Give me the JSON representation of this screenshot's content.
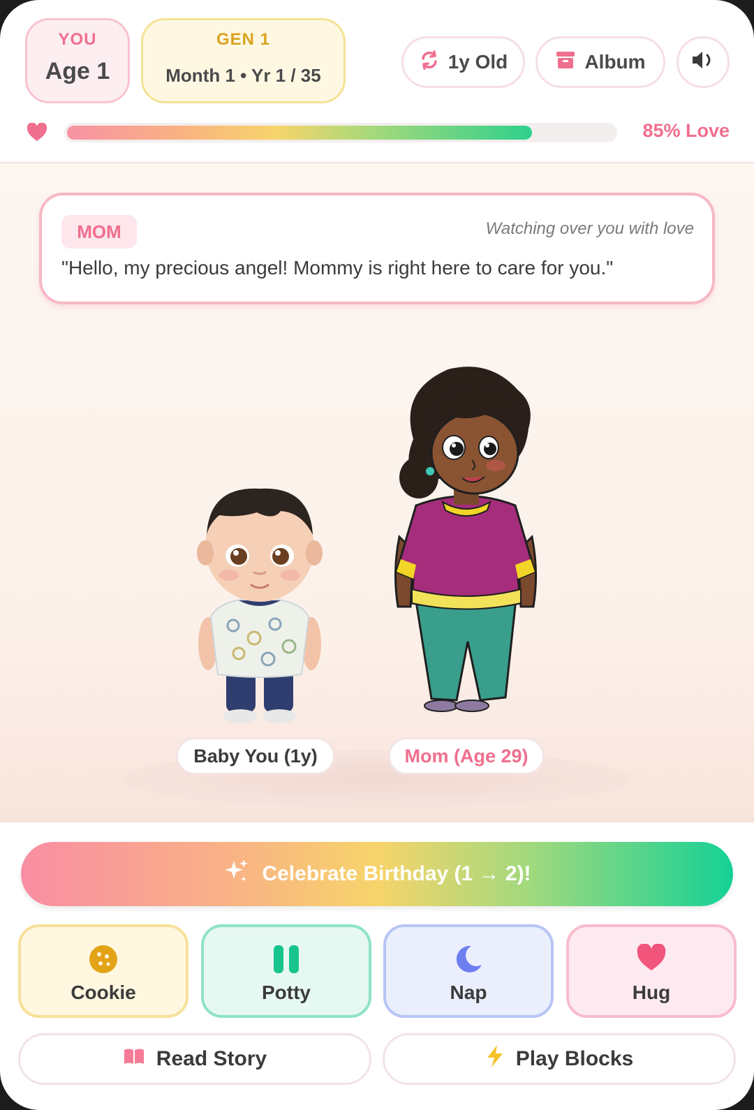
{
  "header": {
    "you_chip": {
      "label": "YOU",
      "value": "Age 1"
    },
    "gen_chip": {
      "label": "GEN 1",
      "value": "Month 1 • Yr 1 / 35"
    },
    "age_button": {
      "label": "1y Old",
      "icon": "refresh-icon"
    },
    "album_button": {
      "label": "Album",
      "icon": "archive-icon"
    },
    "sound_button": {
      "icon": "speaker-icon"
    }
  },
  "love": {
    "percent": 85,
    "label": "85% Love",
    "icon": "heart-icon"
  },
  "speech": {
    "speaker": "MOM",
    "subtitle": "Watching over you with love",
    "text": "\"Hello, my precious angel! Mommy is right here to care for you.\""
  },
  "characters": {
    "baby": {
      "name": "Baby You (1y)"
    },
    "mom": {
      "name": "Mom (Age 29)"
    }
  },
  "actions": {
    "celebrate": {
      "label": "Celebrate Birthday (1 → 2)!",
      "icon": "sparkles-icon"
    },
    "cookie": {
      "label": "Cookie",
      "icon": "cookie-icon"
    },
    "potty": {
      "label": "Potty",
      "icon": "potty-icon"
    },
    "nap": {
      "label": "Nap",
      "icon": "moon-icon"
    },
    "hug": {
      "label": "Hug",
      "icon": "heart-icon"
    },
    "story": {
      "label": "Read Story",
      "icon": "book-icon"
    },
    "blocks": {
      "label": "Play Blocks",
      "icon": "lightning-icon"
    }
  },
  "colors": {
    "accent_pink": "#f06f8e",
    "gold": "#d9a21f",
    "potty_green": "#18c48e",
    "nap_blue": "#6d7ff0"
  }
}
